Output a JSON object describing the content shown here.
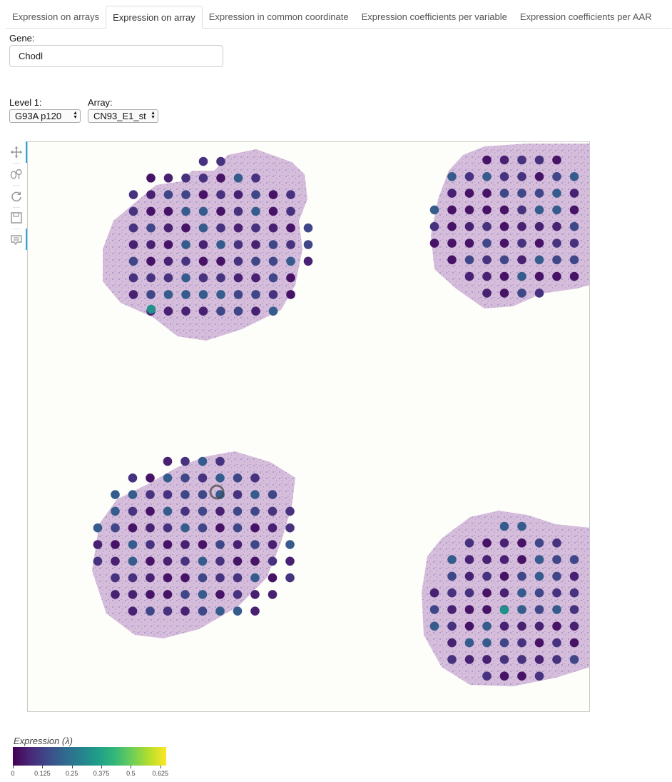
{
  "tabs": [
    {
      "label": "Expression on arrays",
      "active": false
    },
    {
      "label": "Expression on array",
      "active": true
    },
    {
      "label": "Expression in common coordinate",
      "active": false
    },
    {
      "label": "Expression coefficients per variable",
      "active": false
    },
    {
      "label": "Expression coefficients per AAR",
      "active": false
    }
  ],
  "gene": {
    "label": "Gene:",
    "value": "Chodl"
  },
  "level1": {
    "label": "Level 1:",
    "selected": "G93A p120"
  },
  "array": {
    "label": "Array:",
    "selected": "CN93_E1_st"
  },
  "toolbar": {
    "tools": [
      "pan-icon",
      "box-zoom-icon",
      "reset-icon",
      "save-icon",
      "hover-icon"
    ]
  },
  "colorbar": {
    "title": "Expression (λ)",
    "colormap": "viridis",
    "ticks": [
      "0",
      "0.125",
      "0.25",
      "0.375",
      "0.5",
      "0.625"
    ],
    "tick_values": [
      0,
      0.125,
      0.25,
      0.375,
      0.5,
      0.625
    ],
    "max": 0.65
  },
  "colors": {
    "tab_border": "#dddddd",
    "tool_active": "#26aae1",
    "tissue": "#c8a6cf",
    "low": "#440154",
    "mid": "#3b528b",
    "high": "#21918c"
  }
}
